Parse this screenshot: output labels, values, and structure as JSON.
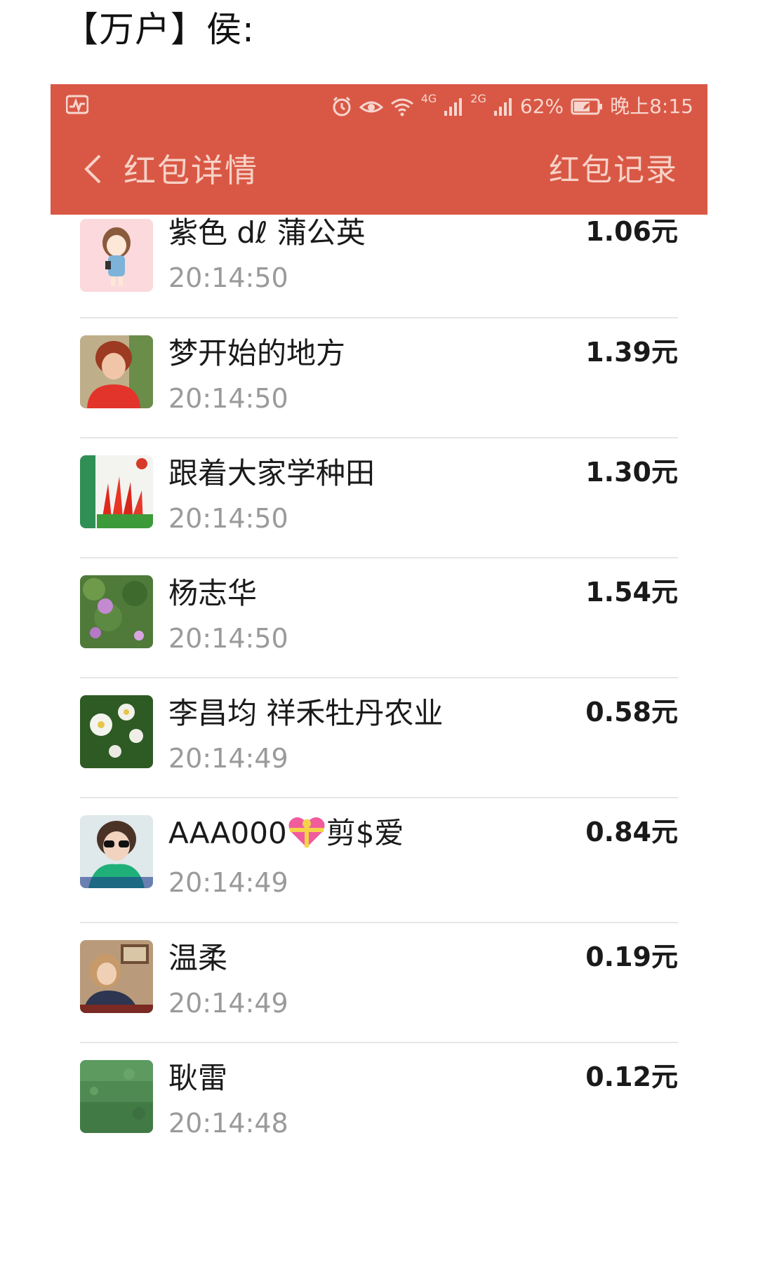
{
  "post_title": "【万户】侯:",
  "status_bar": {
    "net1": "4G",
    "net2": "2G",
    "battery": "62%",
    "time": "晚上8:15"
  },
  "nav": {
    "title": "红包详情",
    "right_link": "红包记录"
  },
  "records": [
    {
      "name": "紫色 dℓ 蒲公英",
      "time": "20:14:50",
      "amount": "1.06元",
      "avatar": "cartoon-girl-avatar"
    },
    {
      "name": "梦开始的地方",
      "time": "20:14:50",
      "amount": "1.39元",
      "avatar": "woman-red-shirt-avatar"
    },
    {
      "name": "跟着大家学种田",
      "time": "20:14:50",
      "amount": "1.30元",
      "avatar": "seed-packet-avatar"
    },
    {
      "name": "杨志华",
      "time": "20:14:50",
      "amount": "1.54元",
      "avatar": "peony-flowers-avatar"
    },
    {
      "name": "李昌均  祥禾牡丹农业",
      "time": "20:14:49",
      "amount": "0.58元",
      "avatar": "white-flowers-avatar"
    },
    {
      "name_prefix": "AAA000",
      "name_suffix": "剪$爱",
      "time": "20:14:49",
      "amount": "0.84元",
      "avatar": "woman-sunglasses-avatar"
    },
    {
      "name": "温柔",
      "time": "20:14:49",
      "amount": "0.19元",
      "avatar": "woman-indoor-avatar"
    },
    {
      "name": "耿雷",
      "time": "20:14:48",
      "amount": "0.12元",
      "avatar": "green-grass-avatar"
    }
  ],
  "colors": {
    "header_bg": "#d95845",
    "header_text": "#f7d2c8",
    "time_text": "#9a9a9a"
  }
}
